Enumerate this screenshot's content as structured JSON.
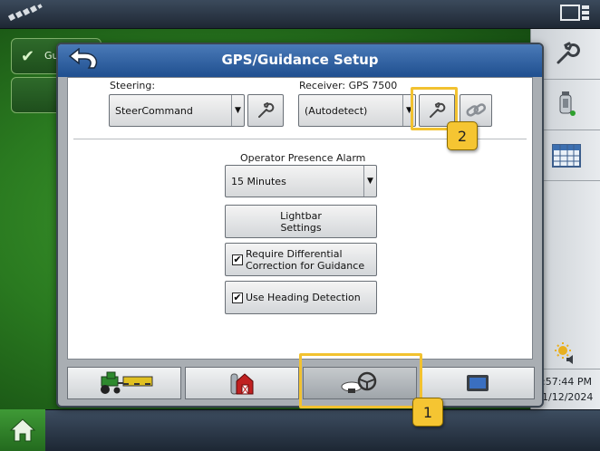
{
  "dialog": {
    "title": "GPS/Guidance Setup"
  },
  "background": {
    "card_label": "Gu"
  },
  "steering": {
    "label": "Steering:",
    "value": "SteerCommand"
  },
  "receiver": {
    "label": "Receiver: GPS 7500",
    "value": "(Autodetect)"
  },
  "alarm": {
    "label": "Operator Presence Alarm",
    "value": "15 Minutes"
  },
  "buttons": {
    "lightbar_line1": "Lightbar",
    "lightbar_line2": "Settings",
    "diff_line1": "Require Differential",
    "diff_line2": "Correction for Guidance",
    "diff_checked": "✔",
    "heading": "Use Heading Detection",
    "heading_checked": "✔"
  },
  "callouts": {
    "one": "1",
    "two": "2"
  },
  "clock": {
    "time": ":57:44 PM",
    "date": "1/12/2024"
  },
  "colors": {
    "header": "#2a5d9f",
    "callout": "#f2c230",
    "background_green": "#2a7a20"
  }
}
